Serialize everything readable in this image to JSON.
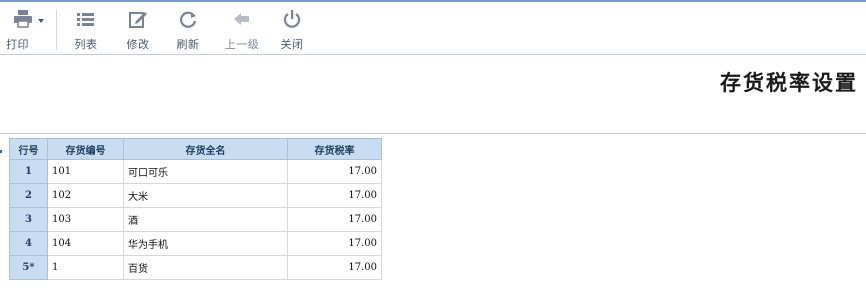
{
  "toolbar": {
    "print_label": "打印",
    "list_label": "列表",
    "edit_label": "修改",
    "refresh_label": "刷新",
    "up_label": "上一级",
    "close_label": "关闭"
  },
  "page": {
    "title": "存货税率设置"
  },
  "table": {
    "headers": [
      "行号",
      "存货编号",
      "存货全名",
      "存货税率"
    ],
    "rows": [
      {
        "rowno": "1",
        "code": "101",
        "name": "可口可乐",
        "rate": "17.00"
      },
      {
        "rowno": "2",
        "code": "102",
        "name": "大米",
        "rate": "17.00"
      },
      {
        "rowno": "3",
        "code": "103",
        "name": "酒",
        "rate": "17.00"
      },
      {
        "rowno": "4",
        "code": "104",
        "name": "华为手机",
        "rate": "17.00"
      },
      {
        "rowno": "5*",
        "code": "1",
        "name": "百货",
        "rate": "17.00"
      }
    ]
  },
  "colors": {
    "accent": "#6f9fd0",
    "header_bg": "#c9ddf0",
    "icon_gray": "#7a8494",
    "icon_disabled": "#b8bec8"
  }
}
